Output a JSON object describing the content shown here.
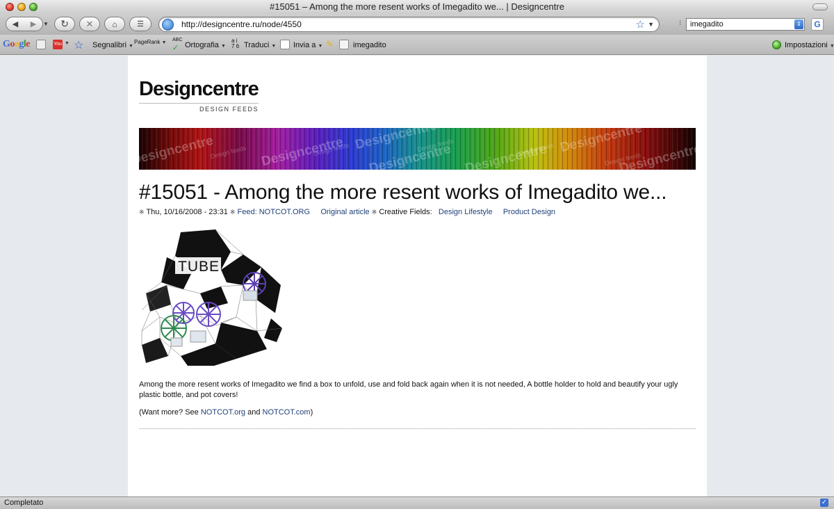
{
  "window": {
    "title": "#15051 – Among the more resent works of Imegadito we... | Designcentre"
  },
  "nav": {
    "url": "http://designcentre.ru/node/4550",
    "search_value": "imegadito"
  },
  "google_toolbar": {
    "logo": "Google",
    "bookmarks_label": "Segnalibri",
    "pagerank_label": "PageRank",
    "spelling_label": "Ortografia",
    "spelling_icon_text": "ABC",
    "translate_label": "Traduci",
    "translate_icon_text": "a i\n7 6",
    "send_label": "Invia a",
    "search_term": "imegadito",
    "settings_label": "Impostazioni"
  },
  "site": {
    "logo": "Designcentre",
    "tagline": "DESIGN FEEDS",
    "banner_word": "Designcentre",
    "banner_small_word": "Design feeds"
  },
  "article": {
    "title": "#15051 - Among the more resent works of Imegadito we...",
    "date": "Thu, 10/16/2008 - 23:31",
    "feed_link": "Feed: NOTCOT.ORG",
    "original_link": "Original article",
    "fields_label": "Creative Fields:",
    "field_1": "Design Lifestyle",
    "field_2": "Product Design",
    "image_text": "TUBE",
    "body_1": "Among the more resent works of Imegadito we find a box to unfold, use and fold back again when it is not needed, A bottle holder to hold and beautify your ugly plastic bottle, and pot covers!",
    "more_prefix": "(Want more? See ",
    "more_link_1": "NOTCOT.org",
    "more_and": " and ",
    "more_link_2": "NOTCOT.com",
    "more_suffix": ")"
  },
  "status": {
    "text": "Completato"
  }
}
